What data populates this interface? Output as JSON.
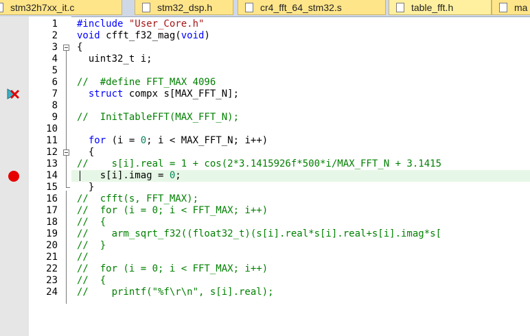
{
  "tabs": [
    {
      "label": "stm32h7xx_it.c",
      "bg": "#ffe58a"
    },
    {
      "label": "stm32_dsp.h",
      "bg": "#ffe58a"
    },
    {
      "label": "cr4_fft_64_stm32.s",
      "bg": "#ffe58a"
    },
    {
      "label": "table_fft.h",
      "bg": "#fff0a0"
    },
    {
      "label": "ma",
      "bg": "#ffe58a"
    }
  ],
  "lines": [
    {
      "n": "1",
      "seg": [
        {
          "t": "#include ",
          "c": "kw"
        },
        {
          "t": "\"User_Core.h\"",
          "c": "str"
        }
      ]
    },
    {
      "n": "2",
      "seg": [
        {
          "t": "void",
          "c": "kw"
        },
        {
          "t": " cfft_f32_mag(",
          "c": ""
        },
        {
          "t": "void",
          "c": "kw"
        },
        {
          "t": ")",
          "c": ""
        }
      ]
    },
    {
      "n": "3",
      "seg": [
        {
          "t": "{",
          "c": ""
        }
      ]
    },
    {
      "n": "4",
      "seg": [
        {
          "t": "  uint32_t i;",
          "c": ""
        }
      ]
    },
    {
      "n": "5",
      "seg": [
        {
          "t": "",
          "c": ""
        }
      ]
    },
    {
      "n": "6",
      "seg": [
        {
          "t": "//  #define FFT_MAX 4096",
          "c": "cm"
        }
      ]
    },
    {
      "n": "7",
      "seg": [
        {
          "t": "  struct",
          "c": "kw"
        },
        {
          "t": " compx s[MAX_FFT_N];",
          "c": ""
        }
      ]
    },
    {
      "n": "8",
      "seg": [
        {
          "t": "",
          "c": ""
        }
      ]
    },
    {
      "n": "9",
      "seg": [
        {
          "t": "//  InitTableFFT(MAX_FFT_N);",
          "c": "cm"
        }
      ]
    },
    {
      "n": "10",
      "seg": [
        {
          "t": "",
          "c": ""
        }
      ]
    },
    {
      "n": "11",
      "seg": [
        {
          "t": "  for",
          "c": "kw"
        },
        {
          "t": " (i = ",
          "c": ""
        },
        {
          "t": "0",
          "c": "num"
        },
        {
          "t": "; i < MAX_FFT_N; i++)",
          "c": ""
        }
      ]
    },
    {
      "n": "12",
      "seg": [
        {
          "t": "  {",
          "c": ""
        }
      ]
    },
    {
      "n": "13",
      "seg": [
        {
          "t": "//    s[i].real = 1 + cos(2*3.1415926f*500*i/MAX_FFT_N + 3.1415",
          "c": "cm"
        }
      ]
    },
    {
      "n": "14",
      "seg": [
        {
          "t": "    s[i].imag = ",
          "c": ""
        },
        {
          "t": "0",
          "c": "num"
        },
        {
          "t": ";",
          "c": ""
        }
      ]
    },
    {
      "n": "15",
      "seg": [
        {
          "t": "  }",
          "c": ""
        }
      ]
    },
    {
      "n": "16",
      "seg": [
        {
          "t": "//  cfft(s, FFT_MAX);",
          "c": "cm"
        }
      ]
    },
    {
      "n": "17",
      "seg": [
        {
          "t": "//  for (i = 0; i < FFT_MAX; i++)",
          "c": "cm"
        }
      ]
    },
    {
      "n": "18",
      "seg": [
        {
          "t": "//  {",
          "c": "cm"
        }
      ]
    },
    {
      "n": "19",
      "seg": [
        {
          "t": "//    arm_sqrt_f32((float32_t)(s[i].real*s[i].real+s[i].imag*s[",
          "c": "cm"
        }
      ]
    },
    {
      "n": "20",
      "seg": [
        {
          "t": "//  }",
          "c": "cm"
        }
      ]
    },
    {
      "n": "21",
      "seg": [
        {
          "t": "//",
          "c": "cm"
        }
      ]
    },
    {
      "n": "22",
      "seg": [
        {
          "t": "//  for (i = 0; i < FFT_MAX; i++)",
          "c": "cm"
        }
      ]
    },
    {
      "n": "23",
      "seg": [
        {
          "t": "//  {",
          "c": "cm"
        }
      ]
    },
    {
      "n": "24",
      "seg": [
        {
          "t": "//    printf(\"%f\\r\\n\", s[i].real);",
          "c": "cm"
        }
      ]
    }
  ],
  "breakpoint_line": "14",
  "disabled_breakpoint_line": "7",
  "highlight_line": "14"
}
